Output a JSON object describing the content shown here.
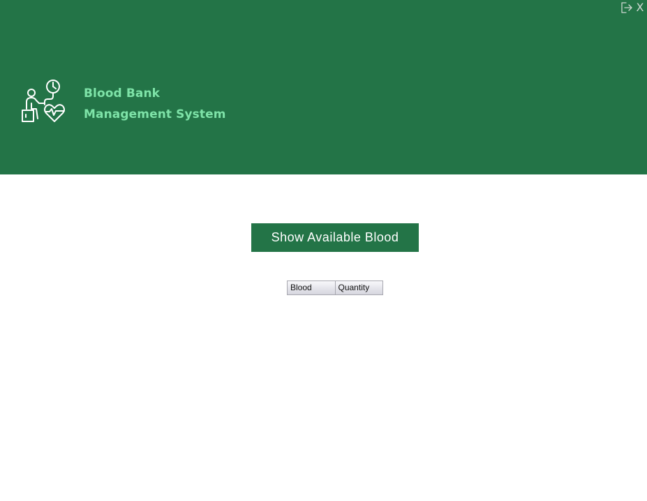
{
  "header": {
    "title_line1": "Blood Bank",
    "title_line2": "Management System",
    "background_color": "#237447",
    "title_color": "#7ee3a8",
    "logo_icon": "blood-pressure-patient-icon"
  },
  "window_controls": {
    "logout_icon": "logout-icon",
    "close_label": "X"
  },
  "main": {
    "show_button_label": "Show Available Blood",
    "table": {
      "columns": [
        "Blood",
        "Quantity"
      ],
      "rows": []
    }
  }
}
